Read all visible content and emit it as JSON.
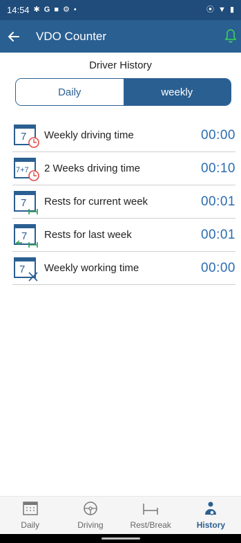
{
  "status_bar": {
    "time": "14:54",
    "left_glyphs": [
      "✱",
      "G",
      "■",
      "⚙",
      "•"
    ],
    "right_glyphs": [
      "⦿",
      "▼",
      "▮"
    ]
  },
  "app_bar": {
    "title": "VDO Counter",
    "back_icon": "arrow-left-icon",
    "right_icon": "bell-icon",
    "accent": "#2a5f91",
    "bell_color": "#39d353"
  },
  "history_title": "Driver History",
  "tabs": [
    {
      "label": "Daily",
      "active": false
    },
    {
      "label": "weekly",
      "active": true
    }
  ],
  "rows": [
    {
      "icon_number": "7",
      "icon": "calendar-clock-icon",
      "label": "Weekly driving time",
      "value": "00:00"
    },
    {
      "icon_number": "7+7",
      "icon": "calendar-clock-icon",
      "label": "2 Weeks driving time",
      "value": "00:10"
    },
    {
      "icon_number": "7",
      "icon": "calendar-bed-icon",
      "label": "Rests for current week",
      "value": "00:01"
    },
    {
      "icon_number": "7",
      "icon": "calendar-bed-back-icon",
      "label": "Rests for last week",
      "value": "00:01"
    },
    {
      "icon_number": "7",
      "icon": "calendar-tools-icon",
      "label": "Weekly working time",
      "value": "00:00"
    }
  ],
  "bottom_nav": [
    {
      "label": "Daily",
      "icon": "calendar-grid-icon",
      "active": false
    },
    {
      "label": "Driving",
      "icon": "steering-wheel-icon",
      "active": false
    },
    {
      "label": "Rest/Break",
      "icon": "bed-icon",
      "active": false
    },
    {
      "label": "History",
      "icon": "driver-icon",
      "active": true
    }
  ],
  "colors": {
    "primary": "#2a5f91",
    "status_bar": "#1f4c7a",
    "value_text": "#2b6cb0",
    "icon_red": "#e24a4a",
    "icon_green": "#2e9b57"
  }
}
